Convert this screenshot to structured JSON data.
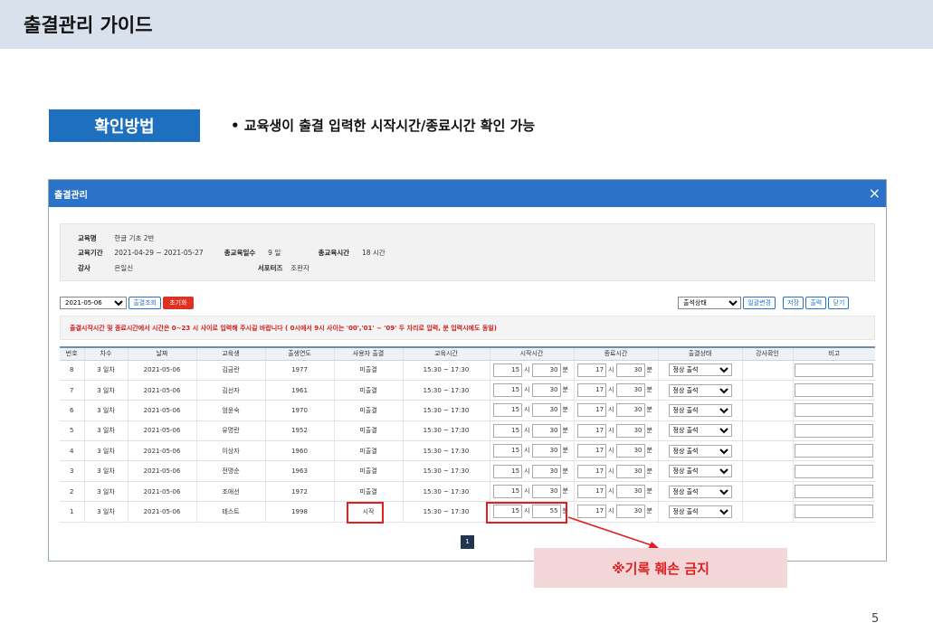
{
  "slide": {
    "title": "출결관리 가이드",
    "method_label": "확인방법",
    "bullet": "•  교육생이 출결 입력한 시작시간/종료시간 확인 가능",
    "callout": "※기록 훼손 금지",
    "page_number": "5"
  },
  "modal": {
    "title": "출결관리",
    "close_icon": "×",
    "info": {
      "course_label": "교육명",
      "course_value": "한글 기초 2반",
      "period_label": "교육기간",
      "period_value": "2021-04-29 ~ 2021-05-27",
      "days_label": "총교육일수",
      "days_value": "9 일",
      "hours_label": "총교육시간",
      "hours_value": "18 시간",
      "teacher_label": "강사",
      "teacher_value": "은일신",
      "supporter_label": "서포터즈",
      "supporter_value": "조완자"
    },
    "controls": {
      "date_select": "2021-05-06",
      "search_button": "출결조회",
      "reset_button": "초기화",
      "status_select": "출석상태",
      "bulk_button": "일괄변경",
      "save_button": "저장",
      "print_button": "출력",
      "close_button": "닫기"
    },
    "notice": "출결시작시간 및 종료시간에서 시간은 0~23 시 사이로 입력해 주시길 바랍니다 ( 0시에서 9시 사이는 '00','01' ~ '09' 두 자리로 입력, 분 입력시에도 동일)",
    "columns": [
      "번호",
      "차수",
      "날짜",
      "교육생",
      "출생연도",
      "사용자 출결",
      "교육시간",
      "시작시간",
      "종료시간",
      "출결상태",
      "강사확인",
      "비고"
    ],
    "units": {
      "hour": "시",
      "minute": "분"
    },
    "rows": [
      {
        "no": "8",
        "round": "3 일차",
        "date": "2021-05-06",
        "name": "김금란",
        "birth": "1977",
        "user_att": "미출결",
        "edu_time": "15:30 ~ 17:30",
        "sh": "15",
        "sm": "30",
        "eh": "17",
        "em": "30",
        "status": "정상 출석"
      },
      {
        "no": "7",
        "round": "3 일차",
        "date": "2021-05-06",
        "name": "김선자",
        "birth": "1961",
        "user_att": "미출결",
        "edu_time": "15:30 ~ 17:30",
        "sh": "15",
        "sm": "30",
        "eh": "17",
        "em": "30",
        "status": "정상 출석"
      },
      {
        "no": "6",
        "round": "3 일차",
        "date": "2021-05-06",
        "name": "엄윤숙",
        "birth": "1970",
        "user_att": "미출결",
        "edu_time": "15:30 ~ 17:30",
        "sh": "15",
        "sm": "30",
        "eh": "17",
        "em": "30",
        "status": "정상 출석"
      },
      {
        "no": "5",
        "round": "3 일차",
        "date": "2021-05-06",
        "name": "유명란",
        "birth": "1952",
        "user_att": "미출결",
        "edu_time": "15:30 ~ 17:30",
        "sh": "15",
        "sm": "30",
        "eh": "17",
        "em": "30",
        "status": "정상 출석"
      },
      {
        "no": "4",
        "round": "3 일차",
        "date": "2021-05-06",
        "name": "이상자",
        "birth": "1960",
        "user_att": "미출결",
        "edu_time": "15:30 ~ 17:30",
        "sh": "15",
        "sm": "30",
        "eh": "17",
        "em": "30",
        "status": "정상 출석"
      },
      {
        "no": "3",
        "round": "3 일차",
        "date": "2021-05-06",
        "name": "전명순",
        "birth": "1963",
        "user_att": "미출결",
        "edu_time": "15:30 ~ 17:30",
        "sh": "15",
        "sm": "30",
        "eh": "17",
        "em": "30",
        "status": "정상 출석"
      },
      {
        "no": "2",
        "round": "3 일차",
        "date": "2021-05-06",
        "name": "조애선",
        "birth": "1972",
        "user_att": "미출결",
        "edu_time": "15:30 ~ 17:30",
        "sh": "15",
        "sm": "30",
        "eh": "17",
        "em": "30",
        "status": "정상 출석"
      },
      {
        "no": "1",
        "round": "3 일차",
        "date": "2021-05-06",
        "name": "테스트",
        "birth": "1998",
        "user_att": "시작",
        "edu_time": "15:30 ~ 17:30",
        "sh": "15",
        "sm": "55",
        "eh": "17",
        "em": "30",
        "status": "정상 출석"
      }
    ],
    "page": "1"
  },
  "colors": {
    "accent": "#2b73c8",
    "highlight": "#e02020"
  }
}
